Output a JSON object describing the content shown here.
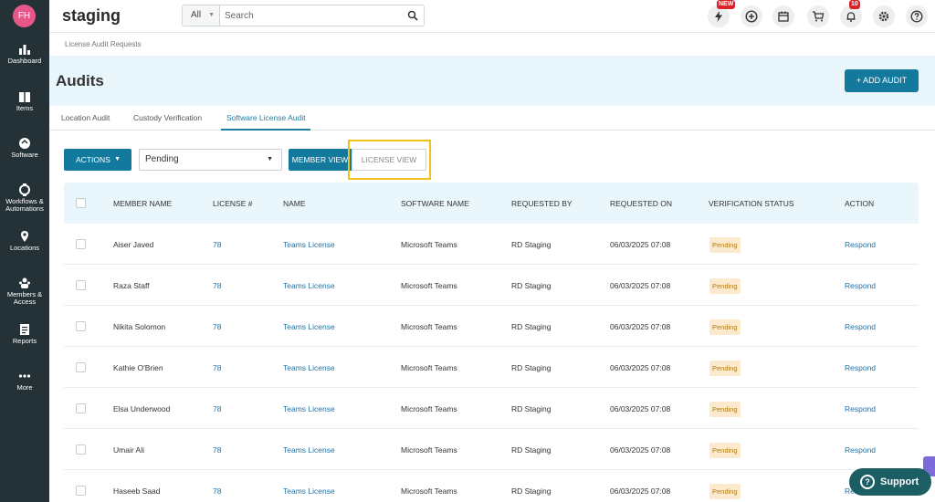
{
  "user": {
    "initials": "FH"
  },
  "sidebar": {
    "items": [
      {
        "label": "Dashboard",
        "icon": "dashboard-icon"
      },
      {
        "label": "Items",
        "icon": "items-icon"
      },
      {
        "label": "Software",
        "icon": "software-icon"
      },
      {
        "label": "Workflows & Automations",
        "icon": "workflows-icon"
      },
      {
        "label": "Locations",
        "icon": "location-pin-icon"
      },
      {
        "label": "Members & Access",
        "icon": "members-icon"
      },
      {
        "label": "Reports",
        "icon": "reports-icon"
      },
      {
        "label": "More",
        "icon": "more-icon"
      }
    ]
  },
  "topbar": {
    "brand": "staging",
    "search": {
      "scope": "All",
      "placeholder": "Search"
    },
    "new_badge": "NEW",
    "notifications_count": "10"
  },
  "breadcrumb": "License Audit Requests",
  "header": {
    "title": "Audits",
    "add_button": "+ ADD AUDIT"
  },
  "tabs": [
    {
      "label": "Location Audit",
      "active": false
    },
    {
      "label": "Custody Verification",
      "active": false
    },
    {
      "label": "Software License Audit",
      "active": true
    }
  ],
  "controls": {
    "actions_label": "ACTIONS",
    "status_value": "Pending",
    "member_view": "MEMBER VIEW",
    "license_view": "LICENSE VIEW"
  },
  "table": {
    "columns": [
      "MEMBER NAME",
      "LICENSE #",
      "NAME",
      "SOFTWARE NAME",
      "REQUESTED BY",
      "REQUESTED ON",
      "VERIFICATION STATUS",
      "ACTION"
    ],
    "rows": [
      {
        "member": "Aiser Javed",
        "license": "78",
        "name": "Teams License",
        "software": "Microsoft Teams",
        "requested_by": "RD Staging",
        "requested_on": "06/03/2025 07:08",
        "status": "Pending",
        "action": "Respond"
      },
      {
        "member": "Raza Staff",
        "license": "78",
        "name": "Teams License",
        "software": "Microsoft Teams",
        "requested_by": "RD Staging",
        "requested_on": "06/03/2025 07:08",
        "status": "Pending",
        "action": "Respond"
      },
      {
        "member": "Nikita Solomon",
        "license": "78",
        "name": "Teams License",
        "software": "Microsoft Teams",
        "requested_by": "RD Staging",
        "requested_on": "06/03/2025 07:08",
        "status": "Pending",
        "action": "Respond"
      },
      {
        "member": "Kathie O'Brien",
        "license": "78",
        "name": "Teams License",
        "software": "Microsoft Teams",
        "requested_by": "RD Staging",
        "requested_on": "06/03/2025 07:08",
        "status": "Pending",
        "action": "Respond"
      },
      {
        "member": "Elsa Underwood",
        "license": "78",
        "name": "Teams License",
        "software": "Microsoft Teams",
        "requested_by": "RD Staging",
        "requested_on": "06/03/2025 07:08",
        "status": "Pending",
        "action": "Respond"
      },
      {
        "member": "Umair Ali",
        "license": "78",
        "name": "Teams License",
        "software": "Microsoft Teams",
        "requested_by": "RD Staging",
        "requested_on": "06/03/2025 07:08",
        "status": "Pending",
        "action": "Respond"
      },
      {
        "member": "Haseeb Saad",
        "license": "78",
        "name": "Teams License",
        "software": "Microsoft Teams",
        "requested_by": "RD Staging",
        "requested_on": "06/03/2025 07:08",
        "status": "Pending",
        "action": "Respond"
      }
    ]
  },
  "support_label": "Support",
  "colors": {
    "sidebar": "#243238",
    "accent": "#137a9e",
    "header_band": "#e9f6fb",
    "pending_bg": "#fbeacd",
    "highlight": "#f2c11b",
    "support": "#1b5e64"
  }
}
